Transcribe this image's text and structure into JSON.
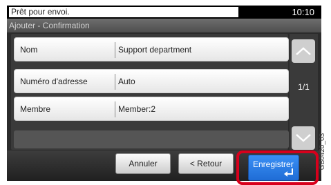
{
  "status": {
    "message": "Prêt pour envoi.",
    "time": "10:10"
  },
  "title": "Ajouter - Confirmation",
  "rows": [
    {
      "label": "Nom",
      "value": "Support department"
    },
    {
      "label": "Numéro d'adresse",
      "value": "Auto"
    },
    {
      "label": "Membre",
      "value": "Member:2"
    }
  ],
  "pager": {
    "page": "1/1",
    "up_icon": "chevron-up-icon",
    "down_icon": "chevron-down-icon"
  },
  "buttons": {
    "cancel": "Annuler",
    "back": "< Retour",
    "save": "Enregistrer",
    "enter_icon": "enter-arrow-icon"
  },
  "figure_code": "GB0420_03",
  "colors": {
    "highlight": "#d8001c",
    "save_button": "#2a7ce8"
  }
}
